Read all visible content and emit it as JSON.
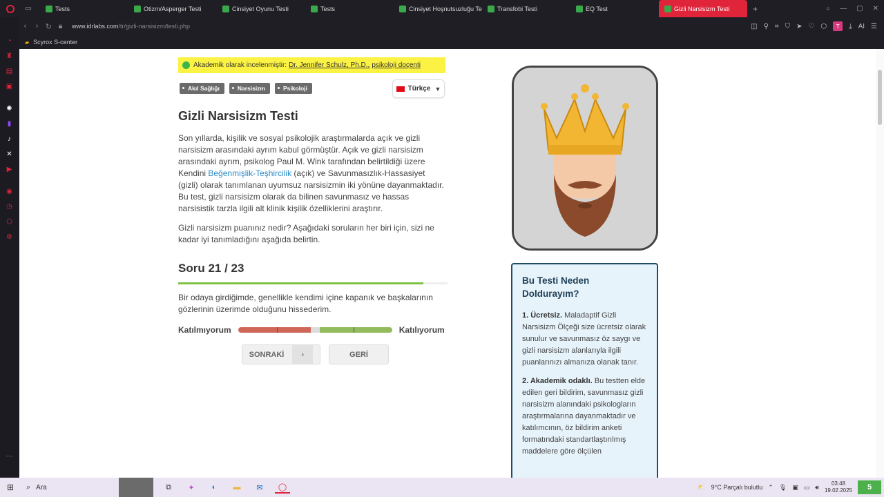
{
  "browser": {
    "tabs": [
      {
        "label": "Tests",
        "active": false
      },
      {
        "label": "Otizm/Asperger Testi",
        "active": false
      },
      {
        "label": "Cinsiyet Oyunu Testi",
        "active": false
      },
      {
        "label": "Tests",
        "active": false
      },
      {
        "label": "Cinsiyet Hoşnutsuzluğu Te",
        "active": false
      },
      {
        "label": "Transfobi Testi",
        "active": false
      },
      {
        "label": "EQ Test",
        "active": false
      },
      {
        "label": "Gizli Narsisizm Testi",
        "active": true
      }
    ],
    "url_host": "www.idrlabs.com",
    "url_path": "/tr/gizli-narsisizm/testi.php",
    "bookmark": "Scyrox S-center",
    "avatar_letter": "T",
    "ai_label": "AI"
  },
  "page": {
    "academic_prefix": "Akademik olarak incelenmiştir:",
    "academic_name": "Dr. Jennifer Schulz, Ph.D.,",
    "academic_role": "psikoloji doçenti",
    "tags": [
      "Akıl Sağlığı",
      "Narsisizm",
      "Psikoloji"
    ],
    "language": "Türkçe",
    "title": "Gizli Narsisizm Testi",
    "intro_before_link": "Son yıllarda, kişilik ve sosyal psikolojik araştırmalarda açık ve gizli narsisizm arasındaki ayrım kabul görmüştür. Açık ve gizli narsisizm arasındaki ayrım, psikolog Paul M. Wink tarafından belirtildiği üzere Kendini ",
    "intro_link": "Beğenmişlik-Teşhircilik",
    "intro_after_link": " (açık) ve Savunmasızlık-Hassasiyet (gizli) olarak tanımlanan uyumsuz narsisizmin iki yönüne dayanmaktadır. Bu test, gizli narsisizm olarak da bilinen savunmasız ve hassas narsisistik tarzla ilgili alt klinik kişilik özelliklerini araştırır.",
    "instruction": "Gizli narsisizm puanınız nedir? Aşağıdaki soruların her biri için, sizi ne kadar iyi tanımladığını aşağıda belirtin.",
    "question_counter": "Soru 21 / 23",
    "progress_fraction": 0.91,
    "question_text": "Bir odaya girdiğimde, genellikle kendimi içine kapanık ve başkalarının gözlerinin üzerimde olduğunu hissederim.",
    "scale_left": "Katılmıyorum",
    "scale_right": "Katılıyorum",
    "next_label": "SONRAKİ",
    "back_label": "GERİ"
  },
  "sidebar_panel": {
    "heading": "Bu Testi Neden Doldurayım?",
    "point1_title": "1. Ücretsiz.",
    "point1_text": " Maladaptif Gizli Narsisizm Ölçeği size ücretsiz olarak sunulur ve savunmasız öz saygı ve gizli narsisizm alanlarıyla ilgili puanlarınızı almanıza olanak tanır.",
    "point2_title": "2. Akademik odaklı.",
    "point2_text": " Bu testten elde edilen geri bildirim, savunmasız gizli narsisizm alanındaki psikologların araştırmalarına dayanmaktadır ve katılımcının, öz bildirim anketi formatındaki standartlaştırılmış maddelere göre ölçülen"
  },
  "taskbar": {
    "search_placeholder": "Ara",
    "weather": "9°C  Parçalı bulutlu",
    "time": "03:48",
    "date": "19.02.2025",
    "notification_count": "5"
  },
  "colors": {
    "accent": "#e0243a",
    "academic_bg": "#fbf244",
    "progress": "#7dc242",
    "scale_disagree": "#cf6758",
    "scale_agree": "#92bb5c",
    "panel_border": "#1e4b66",
    "panel_bg": "#e7f3fb"
  }
}
